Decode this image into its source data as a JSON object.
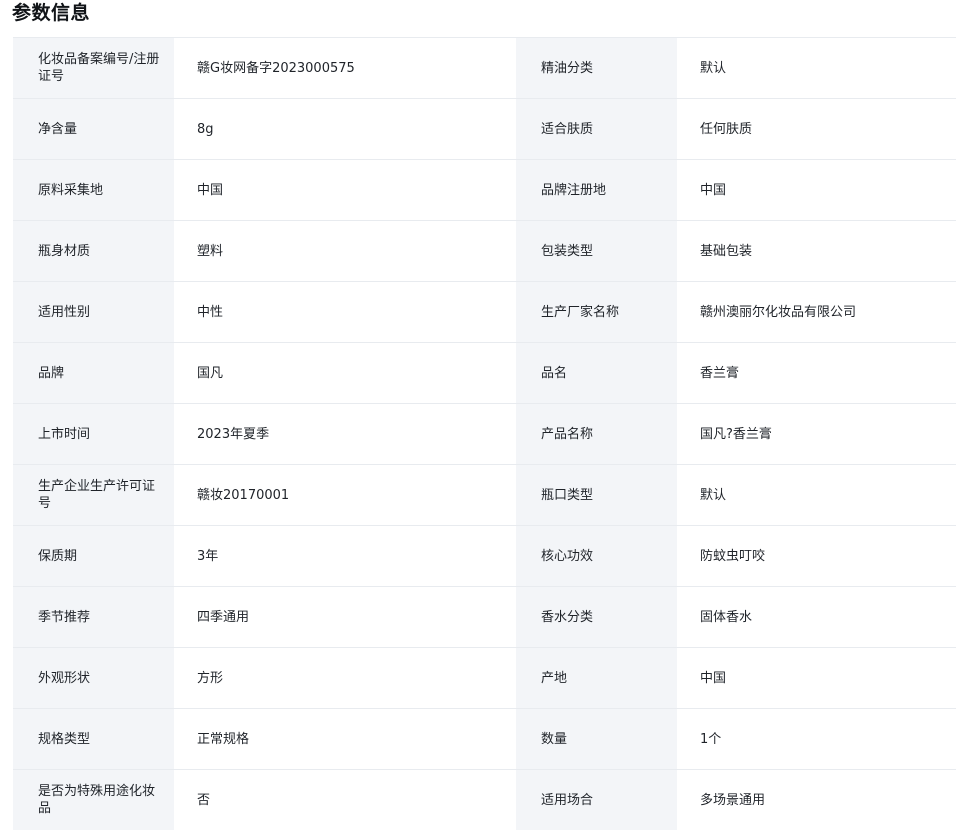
{
  "section_title": "参数信息",
  "rows": [
    [
      {
        "label": "化妆品备案编号/注册证号",
        "value": "赣G妆网备字2023000575"
      },
      {
        "label": "精油分类",
        "value": "默认"
      }
    ],
    [
      {
        "label": "净含量",
        "value": "8g"
      },
      {
        "label": "适合肤质",
        "value": "任何肤质"
      }
    ],
    [
      {
        "label": "原料采集地",
        "value": "中国"
      },
      {
        "label": "品牌注册地",
        "value": "中国"
      }
    ],
    [
      {
        "label": "瓶身材质",
        "value": "塑料"
      },
      {
        "label": "包装类型",
        "value": "基础包装"
      }
    ],
    [
      {
        "label": "适用性别",
        "value": "中性"
      },
      {
        "label": "生产厂家名称",
        "value": "赣州澳丽尔化妆品有限公司"
      }
    ],
    [
      {
        "label": "品牌",
        "value": "国凡"
      },
      {
        "label": "品名",
        "value": "香兰膏"
      }
    ],
    [
      {
        "label": "上市时间",
        "value": "2023年夏季"
      },
      {
        "label": "产品名称",
        "value": "国凡?香兰膏"
      }
    ],
    [
      {
        "label": "生产企业生产许可证号",
        "value": "赣妆20170001"
      },
      {
        "label": "瓶口类型",
        "value": "默认"
      }
    ],
    [
      {
        "label": "保质期",
        "value": "3年"
      },
      {
        "label": "核心功效",
        "value": "防蚊虫叮咬"
      }
    ],
    [
      {
        "label": "季节推荐",
        "value": "四季通用"
      },
      {
        "label": "香水分类",
        "value": "固体香水"
      }
    ],
    [
      {
        "label": "外观形状",
        "value": "方形"
      },
      {
        "label": "产地",
        "value": "中国"
      }
    ],
    [
      {
        "label": "规格类型",
        "value": "正常规格"
      },
      {
        "label": "数量",
        "value": "1个"
      }
    ],
    [
      {
        "label": "是否为特殊用途化妆品",
        "value": "否"
      },
      {
        "label": "适用场合",
        "value": "多场景通用"
      }
    ]
  ]
}
